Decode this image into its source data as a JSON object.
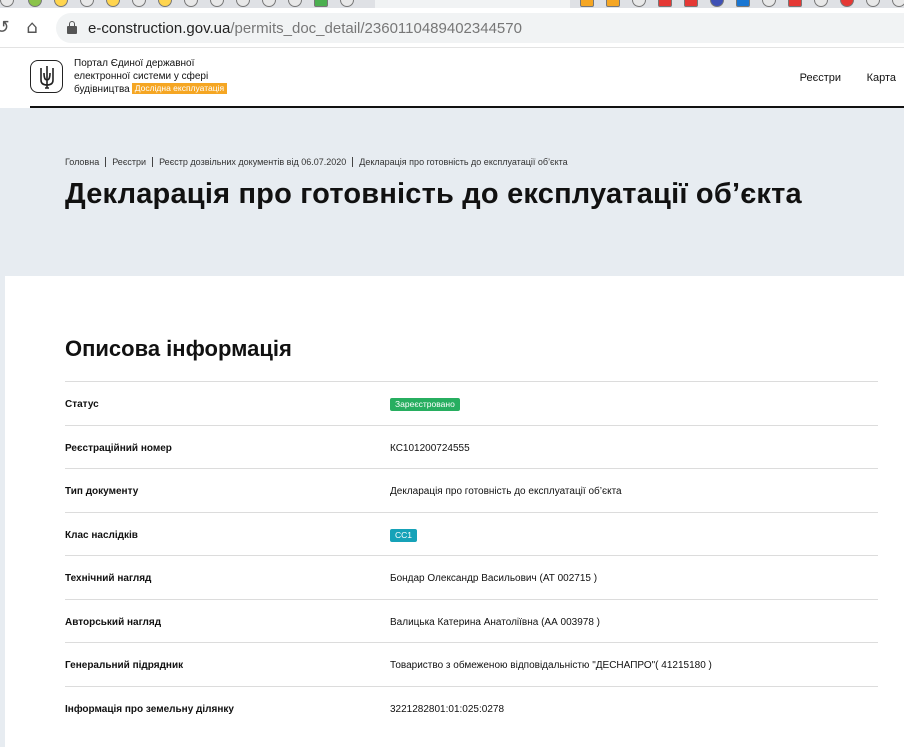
{
  "browser": {
    "url_host": "e-construction.gov.ua",
    "url_path": "/permits_doc_detail/2360110489402344570"
  },
  "header": {
    "portal_line1": "Портал Єдиної державної",
    "portal_line2": "електронної системи у сфері",
    "portal_line3": "будівництва",
    "pilot_badge": "Дослідна експлуатація",
    "nav": [
      "Реєстри",
      "Карта"
    ]
  },
  "hero": {
    "breadcrumb": [
      "Головна",
      "Реєстри",
      "Реєстр дозвільних документів від 06.07.2020",
      "Декларація про готовність до експлуатації об’єкта"
    ],
    "title": "Декларація про готовність до експлуатації об’єкта"
  },
  "section": {
    "title": "Описова інформація",
    "rows": [
      {
        "label": "Статус",
        "value": "Зареєстровано",
        "badge_color": "#27ae60"
      },
      {
        "label": "Реєстраційний номер",
        "value": "КС101200724555"
      },
      {
        "label": "Тип документу",
        "value": "Декларація про готовність до експлуатації об’єкта"
      },
      {
        "label": "Клас наслідків",
        "value": "СС1",
        "badge_color": "#16a2b8"
      },
      {
        "label": "Технічний нагляд",
        "value": "Бондар Олександр Васильович (АТ 002715 )"
      },
      {
        "label": "Авторський нагляд",
        "value": "Валицька Катерина Анатоліївна (АА 003978 )"
      },
      {
        "label": "Генеральний підрядник",
        "value": "Товариство з обмеженою відповідальністю \"ДЕСНАПРО\"( 41215180 )"
      },
      {
        "label": "Інформація про земельну ділянку",
        "value": "3221282801:01:025:0278"
      }
    ]
  },
  "icons": {
    "logo": "trident-icon",
    "lock": "lock-icon",
    "back": "back-icon",
    "home": "home-icon"
  },
  "colors": {
    "hero_bg": "#e7ecf1",
    "pilot_badge": "#f5a623",
    "status_green": "#27ae60",
    "class_teal": "#16a2b8"
  }
}
